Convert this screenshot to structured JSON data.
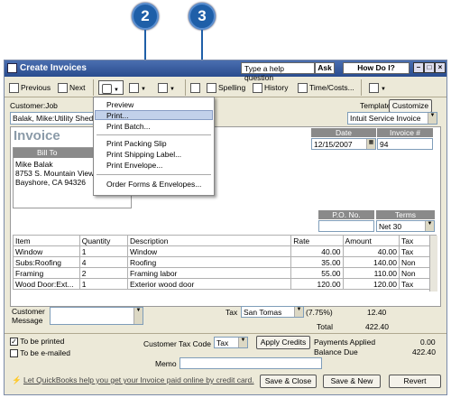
{
  "callouts": {
    "c2": "2",
    "c3": "3"
  },
  "window": {
    "title": "Create Invoices",
    "help_placeholder": "Type a help question",
    "ask": "Ask",
    "how_do_i": "How Do I?",
    "min": "–",
    "restore": "□",
    "close": "×"
  },
  "toolbar": {
    "previous": "Previous",
    "next": "Next",
    "spelling": "Spelling",
    "history": "History",
    "time_costs": "Time/Costs..."
  },
  "customer": {
    "label": "Customer:Job",
    "value": "Balak, Mike:Utility Shed"
  },
  "template": {
    "label": "Template",
    "customize": "Customize",
    "value": "Intuit Service Invoice"
  },
  "invoice": {
    "title": "Invoice",
    "bill_to_label": "Bill To",
    "bill_to": [
      "Mike Balak",
      "8753 S. Mountain View",
      "Bayshore, CA  94326"
    ],
    "date_label": "Date",
    "date": "12/15/2007",
    "num_label": "Invoice #",
    "num": "94",
    "po_label": "P.O. No.",
    "po": "",
    "terms_label": "Terms",
    "terms": "Net 30"
  },
  "menu": {
    "items": [
      "Preview",
      "Print...",
      "Print Batch...",
      "Print Packing Slip",
      "Print Shipping Label...",
      "Print Envelope...",
      "Order Forms & Envelopes..."
    ]
  },
  "table": {
    "headers": [
      "Item",
      "Quantity",
      "Description",
      "Rate",
      "Amount",
      "Tax"
    ],
    "rows": [
      [
        "Window",
        "1",
        "Window",
        "40.00",
        "40.00",
        "Tax"
      ],
      [
        "Subs:Roofing",
        "4",
        "Roofing",
        "35.00",
        "140.00",
        "Non"
      ],
      [
        "Framing",
        "2",
        "Framing labor",
        "55.00",
        "110.00",
        "Non"
      ],
      [
        "Wood Door:Ext...",
        "1",
        "Exterior wood door",
        "120.00",
        "120.00",
        "Tax"
      ]
    ]
  },
  "footer": {
    "customer_message": "Customer\nMessage",
    "customer_message_l1": "Customer",
    "customer_message_l2": "Message",
    "tax_label": "Tax",
    "tax_item": "San Tomas",
    "tax_rate": "(7.75%)",
    "tax_amount": "12.40",
    "total_label": "Total",
    "total": "422.40",
    "to_be_printed": "To be printed",
    "to_be_emailed": "To be e-mailed",
    "tax_code_label": "Customer Tax Code",
    "tax_code": "Tax",
    "apply_credits": "Apply Credits",
    "payments_applied_label": "Payments Applied",
    "payments_applied": "0.00",
    "balance_due_label": "Balance Due",
    "balance_due": "422.40",
    "memo_label": "Memo",
    "online_link": "Let QuickBooks help you get your Invoice paid online by credit card.",
    "save_close": "Save & Close",
    "save_new": "Save & New",
    "revert": "Revert"
  }
}
